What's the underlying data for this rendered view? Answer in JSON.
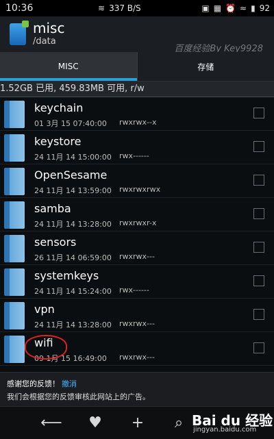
{
  "status": {
    "time": "10:36",
    "speed": "337 B/S",
    "battery": "92"
  },
  "app": {
    "title": "misc",
    "subtitle": "/data",
    "watermark": "百度经验By Key9928"
  },
  "tabs": [
    {
      "label": "MISC"
    },
    {
      "label": "存储"
    }
  ],
  "storage": {
    "text": "1.52GB 已用, 459.83MB 可用, r/w"
  },
  "files": [
    {
      "name": "keychain",
      "date": "01 3月 15 07:40:00",
      "perms": "rwxrwx--x"
    },
    {
      "name": "keystore",
      "date": "24 11月 14 15:00:00",
      "perms": "rwx------"
    },
    {
      "name": "OpenSesame",
      "date": "24 11月 14 13:59:00",
      "perms": "rwxrwxrwx"
    },
    {
      "name": "samba",
      "date": "24 11月 14 13:28:00",
      "perms": "rwxrwxr-x"
    },
    {
      "name": "sensors",
      "date": "26 11月 14 06:59:00",
      "perms": "rwxrwx---"
    },
    {
      "name": "systemkeys",
      "date": "24 11月 14 15:24:00",
      "perms": "rwx------"
    },
    {
      "name": "vpn",
      "date": "24 11月 14 13:28:00",
      "perms": "rwxrwx---"
    },
    {
      "name": "wifi",
      "date": "09 1月 15 16:49:00",
      "perms": "rwxrwx---"
    }
  ],
  "feedback": {
    "title": "感谢您的反馈！",
    "undo": "撤消",
    "message": "我们会根据您的反馈审核此网站上的广告。"
  },
  "nav": {
    "icons": [
      "back-icon",
      "heart-icon",
      "plus-icon",
      "search-icon"
    ]
  },
  "brand": {
    "logo": "Bai du 经验",
    "url": "jingyan.baidu.com"
  },
  "colors": {
    "accent": "#2aa0d8",
    "highlight_circle": "#dd2222"
  }
}
